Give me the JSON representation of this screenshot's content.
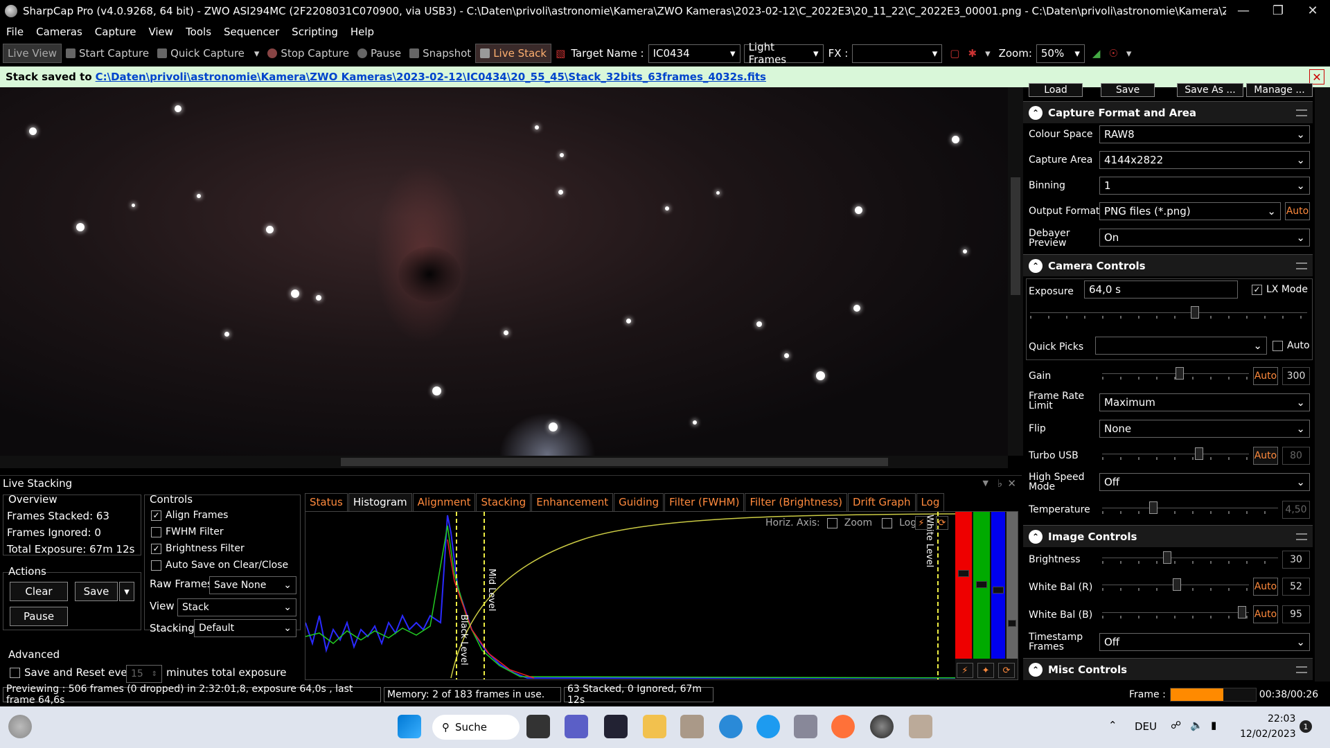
{
  "title": "SharpCap Pro (v4.0.9268, 64 bit) - ZWO ASI294MC (2F2208031C070900, via USB3) - C:\\Daten\\privoli\\astronomie\\Kamera\\ZWO Kameras\\2023-02-12\\C_2022E3\\20_11_22\\C_2022E3_00001.png - C:\\Daten\\privoli\\astronomie\\Kamera\\ZWO Kameras",
  "menu": [
    "File",
    "Cameras",
    "Capture",
    "View",
    "Tools",
    "Sequencer",
    "Scripting",
    "Help"
  ],
  "toolbar": {
    "live_view": "Live View",
    "start_capture": "Start Capture",
    "quick_capture": "Quick Capture",
    "stop_capture": "Stop Capture",
    "pause": "Pause",
    "snapshot": "Snapshot",
    "live_stack": "Live Stack",
    "target_label": "Target Name :",
    "target_value": "IC0434",
    "frame_type": "Light Frames",
    "fx_label": "FX :",
    "fx_value": "",
    "zoom_label": "Zoom:",
    "zoom_value": "50%"
  },
  "banner": {
    "prefix": "Stack saved to",
    "link1": "C:\\Daten\\privoli\\astronomie\\Kamera\\ZWO Kameras\\2023-02-12\\IC0434\\20_55_45",
    "link2": "\\Stack_32bits_63frames_4032s.fits"
  },
  "right": {
    "top_buttons": [
      "Load",
      "Save",
      "Save As ...",
      "Manage ..."
    ],
    "capture_format": {
      "title": "Capture Format and Area",
      "colour_space_label": "Colour Space",
      "colour_space": "RAW8",
      "capture_area_label": "Capture Area",
      "capture_area": "4144x2822",
      "binning_label": "Binning",
      "binning": "1",
      "output_format_label": "Output Format",
      "output_format": "PNG files (*.png)",
      "auto": "Auto",
      "debayer_label": "Debayer Preview",
      "debayer": "On"
    },
    "camera_controls": {
      "title": "Camera Controls",
      "exposure_label": "Exposure",
      "exposure": "64,0 s",
      "lx_mode": "LX Mode",
      "quick_picks_label": "Quick Picks",
      "auto": "Auto",
      "gain_label": "Gain",
      "gain": "300",
      "frame_rate_label": "Frame Rate Limit",
      "frame_rate": "Maximum",
      "flip_label": "Flip",
      "flip": "None",
      "turbo_label": "Turbo USB",
      "turbo": "80",
      "high_speed_label": "High Speed Mode",
      "high_speed": "Off",
      "temperature_label": "Temperature",
      "temperature": "4,50"
    },
    "image_controls": {
      "title": "Image Controls",
      "brightness_label": "Brightness",
      "brightness": "30",
      "wb_r_label": "White Bal (R)",
      "wb_r": "52",
      "wb_b_label": "White Bal (B)",
      "wb_b": "95",
      "timestamp_label": "Timestamp Frames",
      "timestamp": "Off"
    },
    "misc": {
      "title": "Misc Controls"
    }
  },
  "live_stacking": {
    "title": "Live Stacking",
    "overview_title": "Overview",
    "frames_stacked": "Frames Stacked: 63",
    "frames_ignored": "Frames Ignored: 0",
    "total_exposure": "Total Exposure:   67m 12s",
    "actions_title": "Actions",
    "clear": "Clear",
    "save": "Save",
    "pause": "Pause",
    "controls_title": "Controls",
    "align": "Align Frames",
    "fwhm": "FWHM Filter",
    "brightness": "Brightness Filter",
    "autosave": "Auto Save on Clear/Close",
    "raw_frames_label": "Raw Frames",
    "raw_frames": "Save None",
    "view_label": "View",
    "view": "Stack",
    "stacking_label": "Stacking",
    "stacking": "Default",
    "advanced_title": "Advanced",
    "save_reset": "Save and Reset every",
    "minutes_value": "15",
    "minutes_label": "minutes total exposure",
    "tabs": [
      "Status",
      "Histogram",
      "Alignment",
      "Stacking",
      "Enhancement",
      "Guiding",
      "Filter (FWHM)",
      "Filter (Brightness)",
      "Drift Graph",
      "Log"
    ],
    "horiz_axis": "Horiz. Axis:",
    "zoom": "Zoom",
    "log": "Log",
    "black_level": "Black Level",
    "mid_level": "Mid Level",
    "white_level": "White Level"
  },
  "status": {
    "preview": "Previewing : 506 frames (0 dropped) in 2:32:01,8, exposure 64,0s , last frame 64,6s",
    "memory": "Memory: 2 of 183 frames in use.",
    "stacked": "63 Stacked, 0 Ignored, 67m 12s",
    "frame_label": "Frame :",
    "frame_time": "00:38/00:26",
    "frame_progress": 0.62
  },
  "taskbar": {
    "search": "Suche",
    "lang": "DEU",
    "time": "22:03",
    "date": "12/02/2023",
    "badge": "1"
  },
  "colors": {
    "accent": "#ff8a3d",
    "banner_bg": "#d9f7d9",
    "link": "#0044cc"
  }
}
